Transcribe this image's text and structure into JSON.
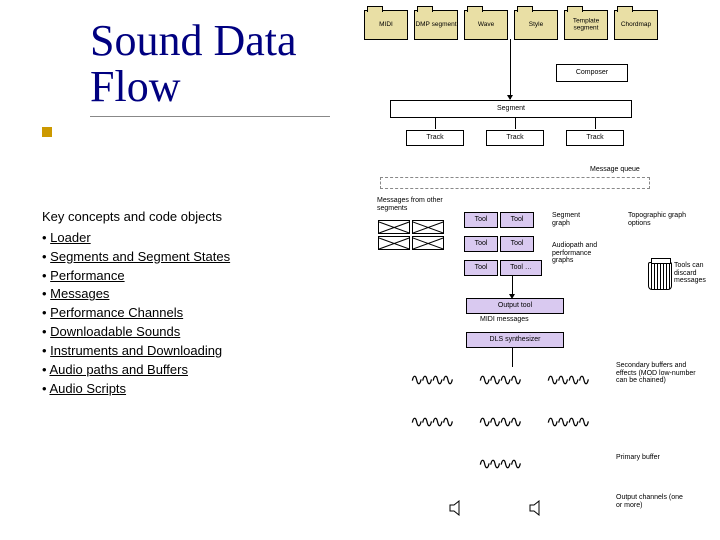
{
  "title": "Sound Data Flow",
  "concepts": {
    "heading": "Key concepts and code objects",
    "items": [
      "Loader",
      "Segments and Segment States",
      "Performance",
      "Messages",
      "Performance Channels",
      "Downloadable Sounds",
      "Instruments and Downloading",
      "Audio paths and Buffers",
      "Audio Scripts"
    ]
  },
  "diagram": {
    "folders": [
      "MIDI",
      "DMP segment",
      "Wave",
      "Style",
      "Template segment",
      "Chordmap"
    ],
    "composer": "Composer",
    "segment": "Segment",
    "tracks": [
      "Track",
      "Track",
      "Track"
    ],
    "msgqueue": "Message queue",
    "msg_other": "Messages from other segments",
    "tool_rows": [
      {
        "left": "Tool",
        "right": "Tool"
      },
      {
        "left": "Tool",
        "right": "Tool"
      },
      {
        "left": "Tool",
        "right": "Tool …"
      }
    ],
    "side_notes": {
      "seg_graph": "Segment graph",
      "ap_graph": "Audiopath and performance graphs",
      "discard": "Tools can discard messages"
    },
    "output_tool": "Output tool",
    "output_sub": "MIDI messages",
    "synth": "DLS synthesizer",
    "right_notes": {
      "topographic": "Topographic graph options",
      "sec_buf": "Secondary buffers and effects (MOD low-number can be chained)",
      "prim_buf": "Primary buffer",
      "out_chan": "Output channels (one or more)"
    }
  }
}
